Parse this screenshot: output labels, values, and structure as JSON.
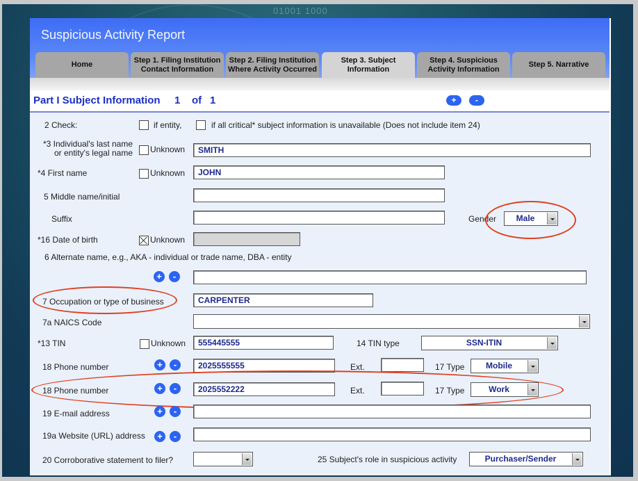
{
  "app": {
    "title": "Suspicious Activity Report"
  },
  "tabs": [
    {
      "line1": "Home",
      "line2": ""
    },
    {
      "line1": "Step 1. Filing Institution",
      "line2": "Contact Information"
    },
    {
      "line1": "Step 2. Filing Institution",
      "line2": "Where Activity Occurred"
    },
    {
      "line1": "Step 3. Subject",
      "line2": "Information",
      "active": true
    },
    {
      "line1": "Step 4. Suspicious",
      "line2": "Activity Information"
    },
    {
      "line1": "Step 5. Narrative",
      "line2": ""
    }
  ],
  "part": {
    "title": "Part I Subject Information",
    "current": "1",
    "of_label": "of",
    "total": "1",
    "add_label": "+",
    "remove_label": "-"
  },
  "form": {
    "check": {
      "label": "2 Check:",
      "entity_label": "if entity,",
      "entity_checked": false,
      "critical_label": "if all critical* subject information is unavailable (Does not include item 24)",
      "critical_checked": false
    },
    "last_name": {
      "label_line1": "*3 Individual's last name",
      "label_line2": "or entity's legal name",
      "unknown_label": "Unknown",
      "unknown_checked": false,
      "value": "SMITH"
    },
    "first_name": {
      "label": "*4 First name",
      "unknown_label": "Unknown",
      "unknown_checked": false,
      "value": "JOHN"
    },
    "middle_name": {
      "label": "5 Middle name/initial",
      "value": ""
    },
    "suffix": {
      "label": "Suffix",
      "value": ""
    },
    "gender": {
      "label": "Gender",
      "value": "Male"
    },
    "dob": {
      "label": "*16 Date of birth",
      "unknown_label": "Unknown",
      "unknown_checked": true,
      "value": ""
    },
    "alt_name": {
      "label": "6 Alternate name, e.g.,  AKA - individual or trade name, DBA - entity",
      "value": ""
    },
    "occupation": {
      "label": "7 Occupation or type of business",
      "value": "CARPENTER"
    },
    "naics": {
      "label": "7a NAICS Code",
      "value": ""
    },
    "tin": {
      "label": "*13 TIN",
      "unknown_label": "Unknown",
      "unknown_checked": false,
      "value": "555445555",
      "type_label": "14 TIN type",
      "type_value": "SSN-ITIN"
    },
    "phones": [
      {
        "label": "18 Phone number",
        "value": "2025555555",
        "ext_label": "Ext.",
        "ext": "",
        "type_label": "17 Type",
        "type": "Mobile"
      },
      {
        "label": "18 Phone number",
        "value": "2025552222",
        "ext_label": "Ext.",
        "ext": "",
        "type_label": "17 Type",
        "type": "Work"
      }
    ],
    "email": {
      "label": "19 E-mail address",
      "value": ""
    },
    "website": {
      "label": "19a Website (URL) address",
      "value": ""
    },
    "corroborative": {
      "label": "20 Corroborative statement to filer?",
      "value": ""
    },
    "role": {
      "label": "25 Subject's role in suspicious activity",
      "value": "Purchaser/Sender"
    }
  },
  "annotation_color": "#e0401e",
  "background_text": "01001 1000"
}
